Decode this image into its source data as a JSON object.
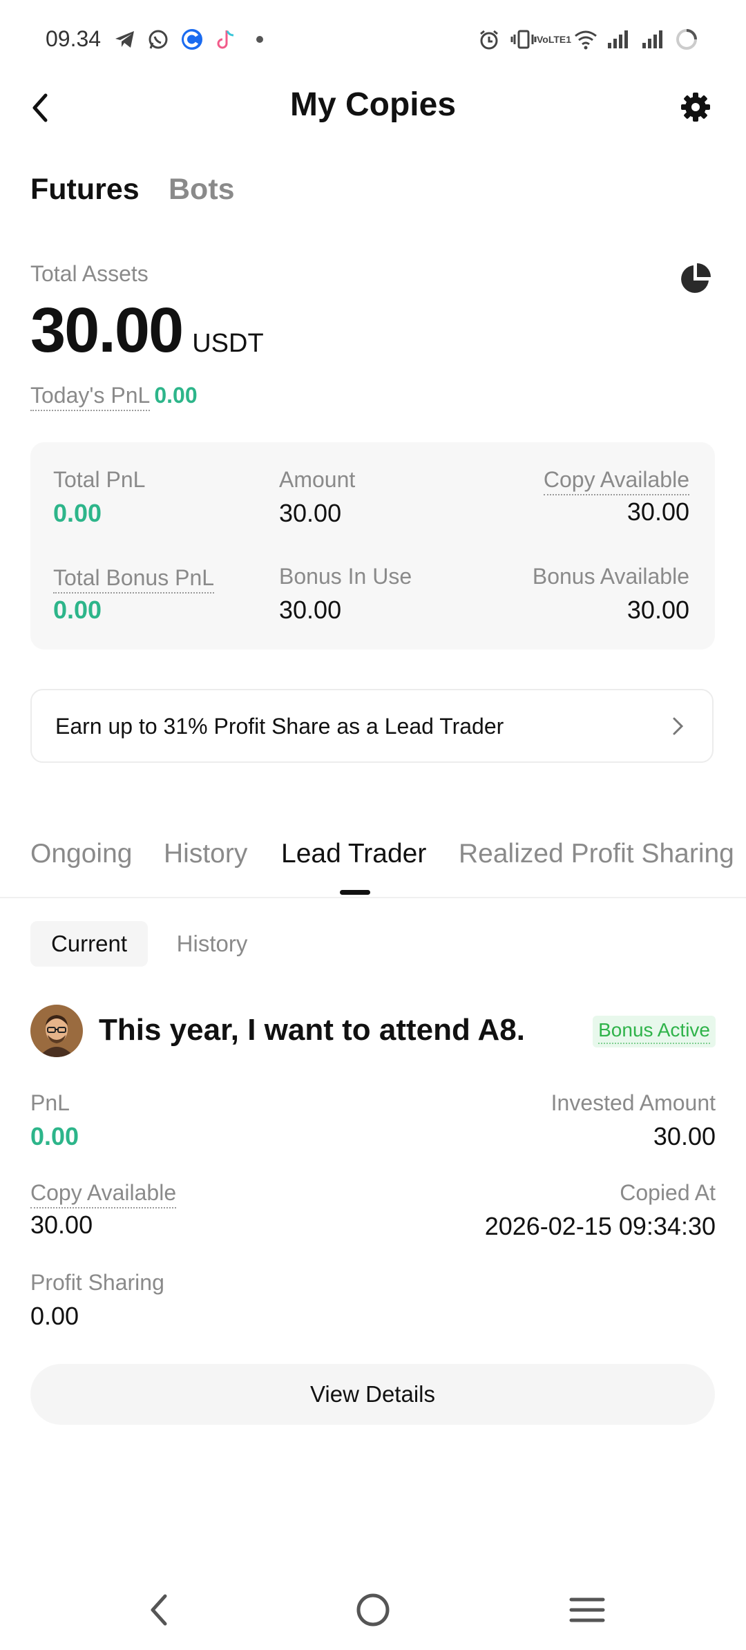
{
  "status_bar": {
    "time": "09.34",
    "icons": [
      "telegram-icon",
      "whatsapp-icon",
      "app-c-icon",
      "tiktok-icon",
      "dot-icon",
      "alarm-icon",
      "vibrate-icon",
      "volte-icon",
      "wifi-icon",
      "signal-icon",
      "signal-icon",
      "battery-ring-icon"
    ],
    "volte_text": "VoLTE1"
  },
  "header": {
    "title": "My Copies"
  },
  "top_tabs": [
    {
      "label": "Futures",
      "active": true
    },
    {
      "label": "Bots",
      "active": false
    }
  ],
  "assets": {
    "label": "Total Assets",
    "value": "30.00",
    "unit": "USDT",
    "today_pnl_label": "Today's PnL",
    "today_pnl_value": "0.00"
  },
  "stats": {
    "total_pnl_label": "Total PnL",
    "total_pnl_value": "0.00",
    "amount_label": "Amount",
    "amount_value": "30.00",
    "copy_available_label": "Copy Available",
    "copy_available_value": "30.00",
    "total_bonus_pnl_label": "Total Bonus PnL",
    "total_bonus_pnl_value": "0.00",
    "bonus_in_use_label": "Bonus In Use",
    "bonus_in_use_value": "30.00",
    "bonus_available_label": "Bonus Available",
    "bonus_available_value": "30.00"
  },
  "banner": {
    "text": "Earn up to 31% Profit Share as a Lead Trader"
  },
  "list_tabs": [
    {
      "label": "Ongoing",
      "active": false
    },
    {
      "label": "History",
      "active": false
    },
    {
      "label": "Lead Trader",
      "active": true
    },
    {
      "label": "Realized Profit Sharing",
      "active": false
    }
  ],
  "sub_tabs": [
    {
      "label": "Current",
      "active": true
    },
    {
      "label": "History",
      "active": false
    }
  ],
  "trader": {
    "name": "This year, I want to attend A8.",
    "badge": "Bonus Active",
    "pnl_label": "PnL",
    "pnl_value": "0.00",
    "invested_label": "Invested Amount",
    "invested_value": "30.00",
    "copy_available_label": "Copy Available",
    "copy_available_value": "30.00",
    "copied_at_label": "Copied At",
    "copied_at_value": "2026-02-15 09:34:30",
    "profit_sharing_label": "Profit Sharing",
    "profit_sharing_value": "0.00",
    "details_button": "View Details"
  },
  "colors": {
    "green": "#2db58a",
    "badge_bg": "#e8f8ec",
    "badge_text": "#2fb34a"
  }
}
